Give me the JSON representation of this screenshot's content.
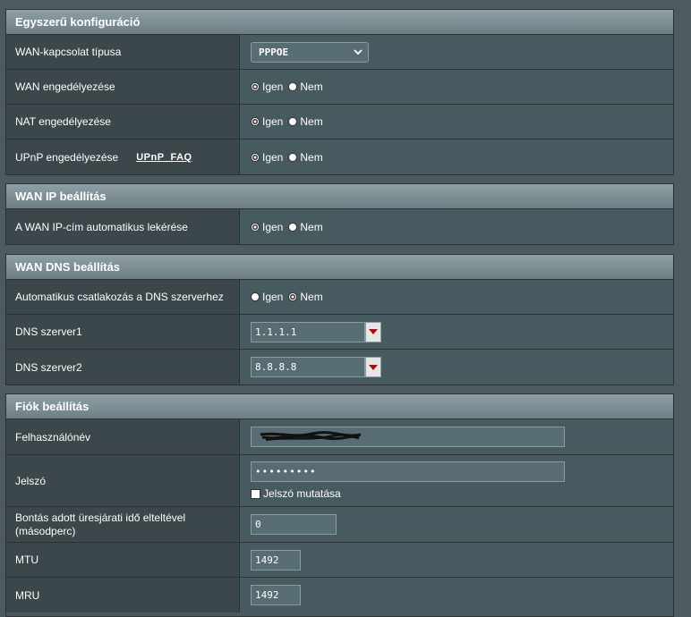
{
  "basic": {
    "title": "Egyszerű konfiguráció",
    "wan_type_label": "WAN-kapcsolat típusa",
    "wan_type_value": "PPPOE",
    "wan_enable_label": "WAN engedélyezése",
    "nat_enable_label": "NAT engedélyezése",
    "upnp_enable_label": "UPnP engedélyezése",
    "upnp_faq": "UPnP  FAQ"
  },
  "radio": {
    "yes": "Igen",
    "no": "Nem"
  },
  "wan_ip": {
    "title": "WAN IP beállítás",
    "auto_ip_label": "A WAN IP-cím automatikus lekérése"
  },
  "wan_dns": {
    "title": "WAN DNS beállítás",
    "auto_dns_label": "Automatikus csatlakozás a DNS szerverhez",
    "dns1_label": "DNS szerver1",
    "dns1_value": "1.1.1.1",
    "dns2_label": "DNS szerver2",
    "dns2_value": "8.8.8.8"
  },
  "account": {
    "title": "Fiók beállítás",
    "username_label": "Felhasználónév",
    "password_label": "Jelszó",
    "password_value": "•••••••••",
    "show_password_label": "Jelszó mutatása",
    "idle_label_line1": "Bontás adott üresjárati idő elteltével",
    "idle_label_line2": "(másodperc)",
    "idle_value": "0",
    "mtu_label": "MTU",
    "mtu_value": "1492",
    "mru_label": "MRU",
    "mru_value": "1492"
  },
  "icons": {
    "select_arrow": "chevron-down-icon",
    "dropdown_arrow": "triangle-down-icon"
  },
  "colors": {
    "header_gradient_top": "#8ea0a5",
    "header_gradient_bottom": "#6d7f84",
    "label_bg": "#3b474a",
    "value_bg": "#475a5f",
    "dropdown_arrow": "#a01010"
  }
}
